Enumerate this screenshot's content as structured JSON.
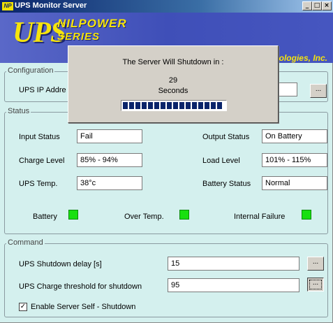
{
  "window": {
    "title": "UPS Monitor Server",
    "icon_text": "NP",
    "controls": {
      "minimize": "_",
      "maximize": "□",
      "close": "×"
    }
  },
  "banner": {
    "logo_main": "UPS",
    "logo_brand": "NILPOWER",
    "logo_brand_line2": "SERIES",
    "company_fragment": "chnologies, Inc."
  },
  "configuration": {
    "label": "Configuration",
    "ip_label": "UPS IP Addre",
    "ip_value": "",
    "browse": "..."
  },
  "status": {
    "label": "Status",
    "input_status_label": "Input Status",
    "input_status_value": "Fail",
    "output_status_label": "Output Status",
    "output_status_value": "On Battery",
    "charge_level_label": "Charge Level",
    "charge_level_value": "85% - 94%",
    "load_level_label": "Load Level",
    "load_level_value": "101% - 115%",
    "ups_temp_label": "UPS Temp.",
    "ups_temp_value": "38°c",
    "battery_status_label": "Battery Status",
    "battery_status_value": "Normal",
    "indicators": {
      "battery": "Battery",
      "over_temp": "Over Temp.",
      "internal_failure": "Internal Failure",
      "led_color": "#18e010"
    }
  },
  "command": {
    "label": "Command",
    "shutdown_delay_label": "UPS Shutdown delay [s]",
    "shutdown_delay_value": "15",
    "charge_threshold_label": "UPS Charge threshold for shutdown",
    "charge_threshold_value": "95",
    "browse": "...",
    "self_shutdown_label": "Enable Server Self - Shutdown",
    "self_shutdown_checked": true,
    "check_mark": "✓"
  },
  "shutdown_dialog": {
    "message": "The Server Will Shutdown in :",
    "countdown": "29",
    "unit": "Seconds",
    "progress_fraction": 0.97
  }
}
